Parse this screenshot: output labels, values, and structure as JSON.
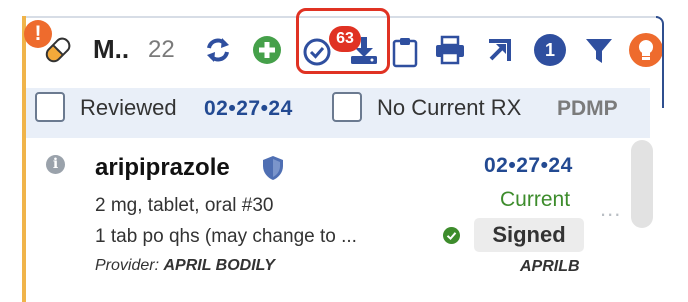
{
  "header": {
    "title": "M..",
    "count": "22",
    "download_badge": "63",
    "notification_badge": "1"
  },
  "filters": {
    "reviewed_label": "Reviewed",
    "reviewed_date": "02•27•24",
    "no_current_rx_label": "No Current RX",
    "pdmp_label": "PDMP"
  },
  "medication": {
    "name": "aripiprazole",
    "dose": "2 mg, tablet, oral #30",
    "sig": "1 tab po qhs (may change to ...",
    "provider_prefix": "Provider:",
    "provider_name": "APRIL BODILY",
    "date": "02•27•24",
    "status": "Current",
    "signed_label": "Signed",
    "signer": "APRILB",
    "more": "..."
  },
  "colors": {
    "accent_orange": "#ee6b2d",
    "highlight_red": "#e03223",
    "primary_blue": "#2f4f9f",
    "green": "#3d8c2c"
  },
  "icons": [
    "warning-icon",
    "pill-icon",
    "refresh-icon",
    "add-icon",
    "check-circle-icon",
    "download-icon",
    "clipboard-icon",
    "print-icon",
    "export-icon",
    "filter-icon",
    "lightbulb-icon",
    "info-icon",
    "shield-icon",
    "check-icon"
  ]
}
